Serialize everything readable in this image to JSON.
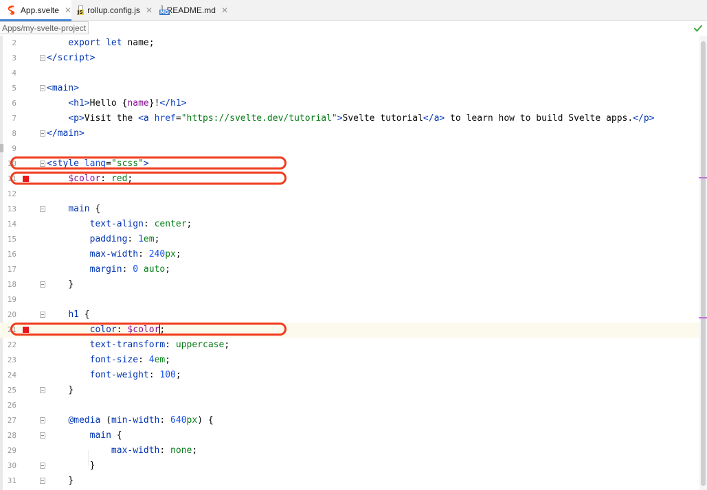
{
  "tabs": [
    {
      "label": "App.svelte",
      "icon": "svelte-icon",
      "active": true
    },
    {
      "label": "rollup.config.js",
      "icon": "js-file-icon",
      "badge": "JS",
      "active": false
    },
    {
      "label": "README.md",
      "icon": "markdown-file-icon",
      "badge": "MD",
      "active": false
    }
  ],
  "tab_close_glyph": "✕",
  "breadcrumb": "Apps/my-svelte-project",
  "status_icon": "check-icon",
  "editor": {
    "caret_line": 21,
    "lines": [
      {
        "n": "2",
        "fold": false,
        "bp": false,
        "tokens": [
          [
            "    ",
            ""
          ],
          [
            "export",
            "kw"
          ],
          [
            " ",
            ""
          ],
          [
            "let",
            "kw"
          ],
          [
            " name;",
            ""
          ]
        ]
      },
      {
        "n": "3",
        "fold": true,
        "bp": false,
        "tokens": [
          [
            "</",
            "tag"
          ],
          [
            "script",
            "tag"
          ],
          [
            ">",
            "tag"
          ]
        ]
      },
      {
        "n": "4",
        "fold": false,
        "bp": false,
        "tokens": []
      },
      {
        "n": "5",
        "fold": true,
        "bp": false,
        "tokens": [
          [
            "<",
            "tag"
          ],
          [
            "main",
            "tag"
          ],
          [
            ">",
            "tag"
          ]
        ]
      },
      {
        "n": "6",
        "fold": false,
        "bp": false,
        "tokens": [
          [
            "    ",
            ""
          ],
          [
            "<",
            "tag"
          ],
          [
            "h1",
            "tag"
          ],
          [
            ">",
            "tag"
          ],
          [
            "Hello ",
            ""
          ],
          [
            "{",
            ""
          ],
          [
            "name",
            "var"
          ],
          [
            "}",
            ""
          ],
          [
            "!",
            ""
          ],
          [
            "</",
            "tag"
          ],
          [
            "h1",
            "tag"
          ],
          [
            ">",
            "tag"
          ]
        ]
      },
      {
        "n": "7",
        "fold": false,
        "bp": false,
        "tokens": [
          [
            "    ",
            ""
          ],
          [
            "<",
            "tag"
          ],
          [
            "p",
            "tag"
          ],
          [
            ">",
            "tag"
          ],
          [
            "Visit the ",
            ""
          ],
          [
            "<",
            "tag"
          ],
          [
            "a",
            "tag"
          ],
          [
            " ",
            ""
          ],
          [
            "href",
            "attr"
          ],
          [
            "=",
            ""
          ],
          [
            "\"https://svelte.dev/tutorial\"",
            "str"
          ],
          [
            ">",
            "tag"
          ],
          [
            "Svelte tutorial",
            ""
          ],
          [
            "</",
            "tag"
          ],
          [
            "a",
            "tag"
          ],
          [
            ">",
            "tag"
          ],
          [
            " to learn how to build Svelte apps.",
            ""
          ],
          [
            "</",
            "tag"
          ],
          [
            "p",
            "tag"
          ],
          [
            ">",
            "tag"
          ]
        ]
      },
      {
        "n": "8",
        "fold": true,
        "bp": false,
        "tokens": [
          [
            "</",
            "tag"
          ],
          [
            "main",
            "tag"
          ],
          [
            ">",
            "tag"
          ]
        ]
      },
      {
        "n": "9",
        "fold": false,
        "bp": false,
        "tokens": []
      },
      {
        "n": "10",
        "fold": true,
        "bp": false,
        "tokens": [
          [
            "<",
            "tag"
          ],
          [
            "style",
            "tag"
          ],
          [
            " ",
            ""
          ],
          [
            "lang",
            "attr"
          ],
          [
            "=",
            ""
          ],
          [
            "\"scss\"",
            "str"
          ],
          [
            ">",
            "tag"
          ]
        ]
      },
      {
        "n": "11",
        "fold": false,
        "bp": true,
        "tokens": [
          [
            "    ",
            ""
          ],
          [
            "$color",
            "var"
          ],
          [
            ": ",
            ""
          ],
          [
            "red",
            "val"
          ],
          [
            ";",
            ""
          ]
        ]
      },
      {
        "n": "12",
        "fold": false,
        "bp": false,
        "tokens": []
      },
      {
        "n": "13",
        "fold": true,
        "bp": false,
        "tokens": [
          [
            "    ",
            ""
          ],
          [
            "main",
            "tag"
          ],
          [
            " {",
            ""
          ]
        ]
      },
      {
        "n": "14",
        "fold": false,
        "bp": false,
        "tokens": [
          [
            "        ",
            ""
          ],
          [
            "text-align",
            "tag"
          ],
          [
            ": ",
            ""
          ],
          [
            "center",
            "val"
          ],
          [
            ";",
            ""
          ]
        ]
      },
      {
        "n": "15",
        "fold": false,
        "bp": false,
        "tokens": [
          [
            "        ",
            ""
          ],
          [
            "padding",
            "tag"
          ],
          [
            ": ",
            ""
          ],
          [
            "1",
            "num"
          ],
          [
            "em",
            "val"
          ],
          [
            ";",
            ""
          ]
        ]
      },
      {
        "n": "16",
        "fold": false,
        "bp": false,
        "tokens": [
          [
            "        ",
            ""
          ],
          [
            "max-width",
            "tag"
          ],
          [
            ": ",
            ""
          ],
          [
            "240",
            "num"
          ],
          [
            "px",
            "val"
          ],
          [
            ";",
            ""
          ]
        ]
      },
      {
        "n": "17",
        "fold": false,
        "bp": false,
        "tokens": [
          [
            "        ",
            ""
          ],
          [
            "margin",
            "tag"
          ],
          [
            ": ",
            ""
          ],
          [
            "0",
            "num"
          ],
          [
            " ",
            ""
          ],
          [
            "auto",
            "val"
          ],
          [
            ";",
            ""
          ]
        ]
      },
      {
        "n": "18",
        "fold": true,
        "bp": false,
        "tokens": [
          [
            "    }",
            ""
          ]
        ]
      },
      {
        "n": "19",
        "fold": false,
        "bp": false,
        "tokens": []
      },
      {
        "n": "20",
        "fold": true,
        "bp": false,
        "tokens": [
          [
            "    ",
            ""
          ],
          [
            "h1",
            "tag"
          ],
          [
            " {",
            ""
          ]
        ]
      },
      {
        "n": "21",
        "fold": false,
        "bp": true,
        "tokens": [
          [
            "        ",
            ""
          ],
          [
            "color",
            "tag"
          ],
          [
            ": ",
            ""
          ],
          [
            "$color",
            "var"
          ],
          [
            "|",
            "caret"
          ],
          [
            ";",
            ""
          ]
        ]
      },
      {
        "n": "22",
        "fold": false,
        "bp": false,
        "tokens": [
          [
            "        ",
            ""
          ],
          [
            "text-transform",
            "tag"
          ],
          [
            ": ",
            ""
          ],
          [
            "uppercase",
            "val"
          ],
          [
            ";",
            ""
          ]
        ]
      },
      {
        "n": "23",
        "fold": false,
        "bp": false,
        "tokens": [
          [
            "        ",
            ""
          ],
          [
            "font-size",
            "tag"
          ],
          [
            ": ",
            ""
          ],
          [
            "4",
            "num"
          ],
          [
            "em",
            "val"
          ],
          [
            ";",
            ""
          ]
        ]
      },
      {
        "n": "24",
        "fold": false,
        "bp": false,
        "tokens": [
          [
            "        ",
            ""
          ],
          [
            "font-weight",
            "tag"
          ],
          [
            ": ",
            ""
          ],
          [
            "100",
            "num"
          ],
          [
            ";",
            ""
          ]
        ]
      },
      {
        "n": "25",
        "fold": true,
        "bp": false,
        "tokens": [
          [
            "    }",
            ""
          ]
        ]
      },
      {
        "n": "26",
        "fold": false,
        "bp": false,
        "tokens": []
      },
      {
        "n": "27",
        "fold": true,
        "bp": false,
        "tokens": [
          [
            "    ",
            ""
          ],
          [
            "@media",
            "kw"
          ],
          [
            " (",
            ""
          ],
          [
            "min-width",
            "tag"
          ],
          [
            ": ",
            ""
          ],
          [
            "640",
            "num"
          ],
          [
            "px",
            "val"
          ],
          [
            ") {",
            ""
          ]
        ]
      },
      {
        "n": "28",
        "fold": true,
        "bp": false,
        "tokens": [
          [
            "        ",
            ""
          ],
          [
            "main",
            "tag"
          ],
          [
            " {",
            ""
          ]
        ]
      },
      {
        "n": "29",
        "fold": false,
        "bp": false,
        "tokens": [
          [
            "            ",
            ""
          ],
          [
            "max-width",
            "tag"
          ],
          [
            ": ",
            ""
          ],
          [
            "none",
            "val"
          ],
          [
            ";",
            ""
          ]
        ]
      },
      {
        "n": "30",
        "fold": true,
        "bp": false,
        "tokens": [
          [
            "        }",
            ""
          ]
        ]
      },
      {
        "n": "31",
        "fold": true,
        "bp": false,
        "tokens": [
          [
            "    }",
            ""
          ]
        ]
      }
    ]
  },
  "colors": {
    "accent": "#4a87d6",
    "breakpoint": "#e8151b",
    "annotation": "#f03a1c",
    "current_line": "#fcfaed"
  }
}
